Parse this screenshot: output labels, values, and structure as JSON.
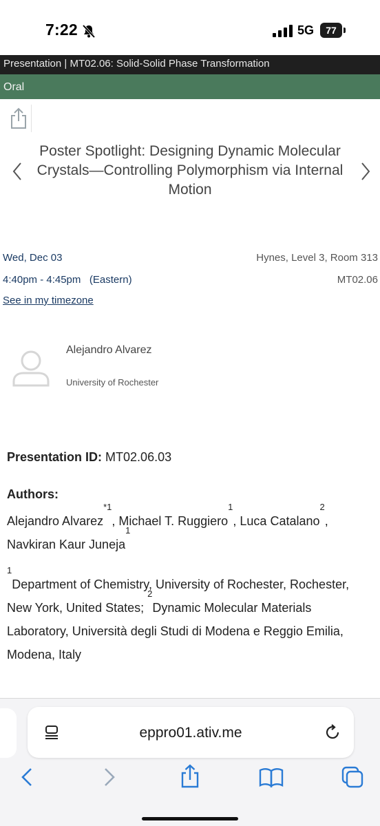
{
  "status_bar": {
    "time": "7:22",
    "network": "5G",
    "battery": "77"
  },
  "header": {
    "breadcrumb": "Presentation | MT02.06: Solid-Solid Phase Transformation",
    "type": "Oral"
  },
  "session": {
    "title": "Poster Spotlight: Designing Dynamic Molecular Crystals—Controlling Polymorphism via Internal Motion",
    "date": "Wed, Dec 03",
    "time": "4:40pm - 4:45pm",
    "timezone": "(Eastern)",
    "timezone_link": "See in my timezone",
    "location": "Hynes, Level 3, Room 313",
    "code": "MT02.06"
  },
  "speaker": {
    "name": "Alejandro Alvarez",
    "affiliation": "University of Rochester"
  },
  "details": {
    "presentation_id_label": "Presentation ID:",
    "presentation_id": "MT02.06.03",
    "authors_heading": "Authors:",
    "authors": [
      {
        "name": "Alejandro Alvarez",
        "mark": "*",
        "sup": "1"
      },
      {
        "name": "Michael T. Ruggiero",
        "mark": "",
        "sup": "1"
      },
      {
        "name": "Luca Catalano",
        "mark": "",
        "sup": "2"
      },
      {
        "name": "Navkiran Kaur Juneja",
        "mark": "",
        "sup": "1"
      }
    ],
    "affiliations": [
      {
        "sup": "1",
        "text": "Department of Chemistry, University of Rochester, Rochester, New York, United States;"
      },
      {
        "sup": "2",
        "text": "Dynamic Molecular Materials Laboratory, Università degli Studi di Modena e Reggio Emilia, Modena, Italy"
      }
    ]
  },
  "browser": {
    "url": "eppro01.ativ.me"
  }
}
